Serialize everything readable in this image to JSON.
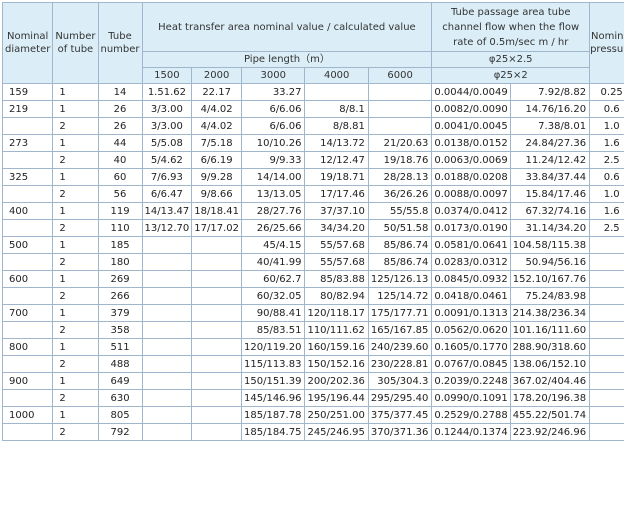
{
  "headers": {
    "nominal_diameter": "Nominal diameter",
    "number_of_tube": "Number of tube",
    "tube_number": "Tube number",
    "heat_transfer": "Heat transfer area nominal value / calculated value",
    "pipe_length": "Pipe length（m）",
    "lengths": [
      "1500",
      "2000",
      "3000",
      "4000",
      "6000"
    ],
    "tube_passage": "Tube passage area tube channel flow when the flow rate of 0.5m/sec m / hr",
    "phi_a": "φ25×2.5",
    "phi_b": "φ25×2",
    "nominal_pressure": "Nominal pressure"
  },
  "rows": [
    [
      "159",
      "1",
      "14",
      "1.51.62",
      "22.17",
      "33.27",
      "",
      "",
      "0.0044/0.0049",
      "7.92/8.82",
      "0.25"
    ],
    [
      "219",
      "1",
      "26",
      "3/3.00",
      "4/4.02",
      "6/6.06",
      "8/8.1",
      "",
      "0.0082/0.0090",
      "14.76/16.20",
      "0.6"
    ],
    [
      "",
      "2",
      "26",
      "3/3.00",
      "4/4.02",
      "6/6.06",
      "8/8.81",
      "",
      "0.0041/0.0045",
      "7.38/8.01",
      "1.0"
    ],
    [
      "273",
      "1",
      "44",
      "5/5.08",
      "7/5.18",
      "10/10.26",
      "14/13.72",
      "21/20.63",
      "0.0138/0.0152",
      "24.84/27.36",
      "1.6"
    ],
    [
      "",
      "2",
      "40",
      "5/4.62",
      "6/6.19",
      "9/9.33",
      "12/12.47",
      "19/18.76",
      "0.0063/0.0069",
      "11.24/12.42",
      "2.5"
    ],
    [
      "325",
      "1",
      "60",
      "7/6.93",
      "9/9.28",
      "14/14.00",
      "19/18.71",
      "28/28.13",
      "0.0188/0.0208",
      "33.84/37.44",
      "0.6"
    ],
    [
      "",
      "2",
      "56",
      "6/6.47",
      "9/8.66",
      "13/13.05",
      "17/17.46",
      "36/26.26",
      "0.0088/0.0097",
      "15.84/17.46",
      "1.0"
    ],
    [
      "400",
      "1",
      "119",
      "14/13.47",
      "18/18.41",
      "28/27.76",
      "37/37.10",
      "55/55.8",
      "0.0374/0.0412",
      "67.32/74.16",
      "1.6"
    ],
    [
      "",
      "2",
      "110",
      "13/12.70",
      "17/17.02",
      "26/25.66",
      "34/34.20",
      "50/51.58",
      "0.0173/0.0190",
      "31.14/34.20",
      "2.5"
    ],
    [
      "500",
      "1",
      "185",
      "",
      "",
      "45/4.15",
      "55/57.68",
      "85/86.74",
      "0.0581/0.0641",
      "104.58/115.38",
      ""
    ],
    [
      "",
      "2",
      "180",
      "",
      "",
      "40/41.99",
      "55/57.68",
      "85/86.74",
      "0.0283/0.0312",
      "50.94/56.16",
      ""
    ],
    [
      "600",
      "1",
      "269",
      "",
      "",
      "60/62.7",
      "85/83.88",
      "125/126.13",
      "0.0845/0.0932",
      "152.10/167.76",
      ""
    ],
    [
      "",
      "2",
      "266",
      "",
      "",
      "60/32.05",
      "80/82.94",
      "125/14.72",
      "0.0418/0.0461",
      "75.24/83.98",
      ""
    ],
    [
      "700",
      "1",
      "379",
      "",
      "",
      "90/88.41",
      "120/118.17",
      "175/177.71",
      "0.0091/0.1313",
      "214.38/236.34",
      ""
    ],
    [
      "",
      "2",
      "358",
      "",
      "",
      "85/83.51",
      "110/111.62",
      "165/167.85",
      "0.0562/0.0620",
      "101.16/111.60",
      ""
    ],
    [
      "800",
      "1",
      "511",
      "",
      "",
      "120/119.20",
      "160/159.16",
      "240/239.60",
      "0.1605/0.1770",
      "288.90/318.60",
      ""
    ],
    [
      "",
      "2",
      "488",
      "",
      "",
      "115/113.83",
      "150/152.16",
      "230/228.81",
      "0.0767/0.0845",
      "138.06/152.10",
      ""
    ],
    [
      "900",
      "1",
      "649",
      "",
      "",
      "150/151.39",
      "200/202.36",
      "305/304.3",
      "0.2039/0.2248",
      "367.02/404.46",
      ""
    ],
    [
      "",
      "2",
      "630",
      "",
      "",
      "145/146.96",
      "195/196.44",
      "295/295.40",
      "0.0990/0.1091",
      "178.20/196.38",
      ""
    ],
    [
      "1000",
      "1",
      "805",
      "",
      "",
      "185/187.78",
      "250/251.00",
      "375/377.45",
      "0.2529/0.2788",
      "455.22/501.74",
      ""
    ],
    [
      "",
      "2",
      "792",
      "",
      "",
      "185/184.75",
      "245/246.95",
      "370/371.36",
      "0.1244/0.1374",
      "223.92/246.96",
      ""
    ]
  ]
}
